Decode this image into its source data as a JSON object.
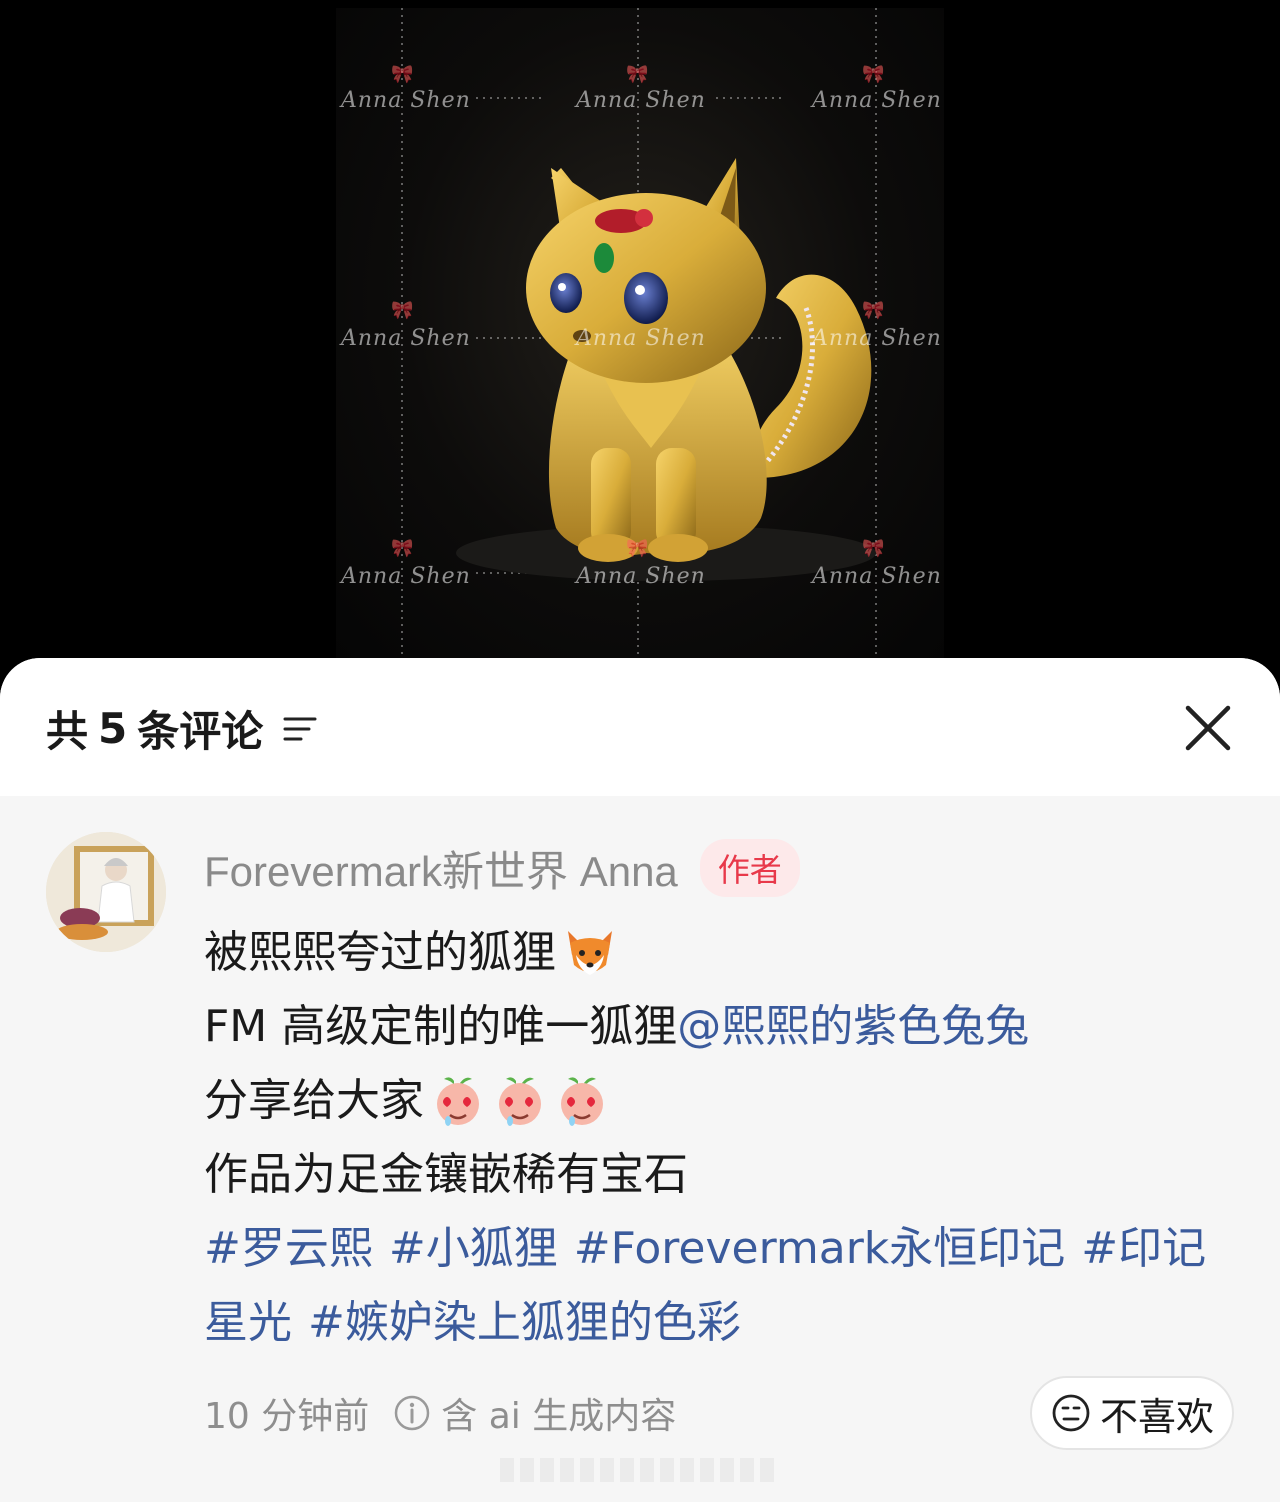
{
  "photo": {
    "watermark_text": "Anna Shen",
    "bow_glyph": "🎀",
    "subject_icon": "golden-fox-figurine-icon"
  },
  "comments_panel": {
    "title_prefix": "共",
    "count": "5",
    "title_suffix": "条评论",
    "sort_icon": "sort-lines-icon",
    "close_icon": "close-icon"
  },
  "comment": {
    "author_name": "Forevermark新世界 Anna",
    "author_badge": "作者",
    "line1": "被熙熙夸过的狐狸",
    "line1_emoji": "fox-face-icon",
    "line2_text": "FM 高级定制的唯一狐狸",
    "line2_mention": "@熙熙的紫色兔兔",
    "line3": "分享给大家",
    "line3_emojis": [
      "heart-eyes-peach-icon",
      "heart-eyes-peach-icon",
      "heart-eyes-peach-icon"
    ],
    "line4": "作品为足金镶嵌稀有宝石",
    "tags_line1": [
      "#罗云熙",
      "#小狐狸",
      "#Forevermark永恒印记",
      "#印记"
    ],
    "tags_line2": [
      "星光",
      "#嫉妒染上狐狸的色彩"
    ],
    "time": "10 分钟前",
    "ai_notice": "含 ai 生成内容",
    "dislike_label": "不喜欢"
  },
  "colors": {
    "link": "#3b5b9c",
    "badge_text": "#e8394a",
    "badge_bg": "#fde9ea",
    "meta": "#8e8e8e",
    "gold": "#d9ad3a"
  }
}
